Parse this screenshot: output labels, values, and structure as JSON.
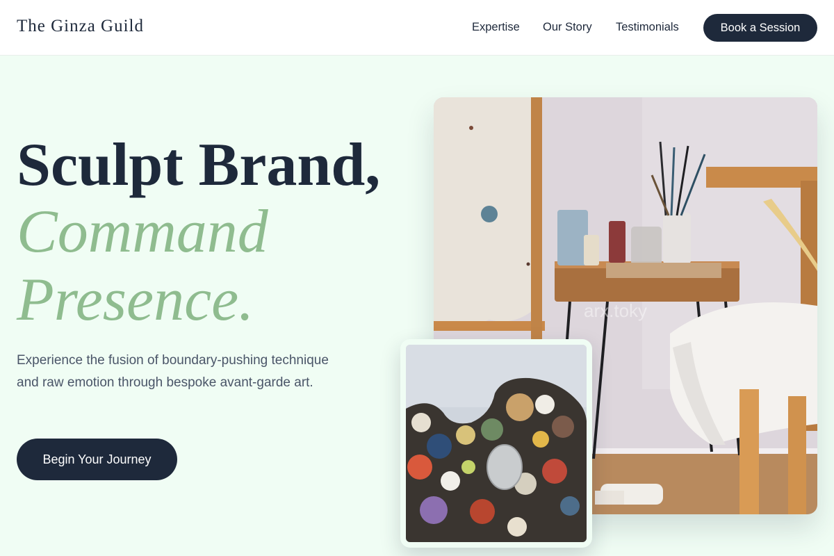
{
  "nav": {
    "logo": "The Ginza Guild",
    "links": [
      "Expertise",
      "Our Story",
      "Testimonials"
    ],
    "cta": "Book a Session"
  },
  "hero": {
    "title_line1": "Sculpt Brand,",
    "title_line2": "Command",
    "title_line3": "Presence.",
    "description": "Experience the fusion of boundary-pushing technique and raw emotion through bespoke avant-garde art.",
    "cta": "Begin Your Journey"
  },
  "images": {
    "main_watermark": "arx.toky"
  },
  "colors": {
    "navy": "#1e293b",
    "sage": "#8fbc8f",
    "background": "#f0fdf4",
    "text_muted": "#4a5568"
  }
}
